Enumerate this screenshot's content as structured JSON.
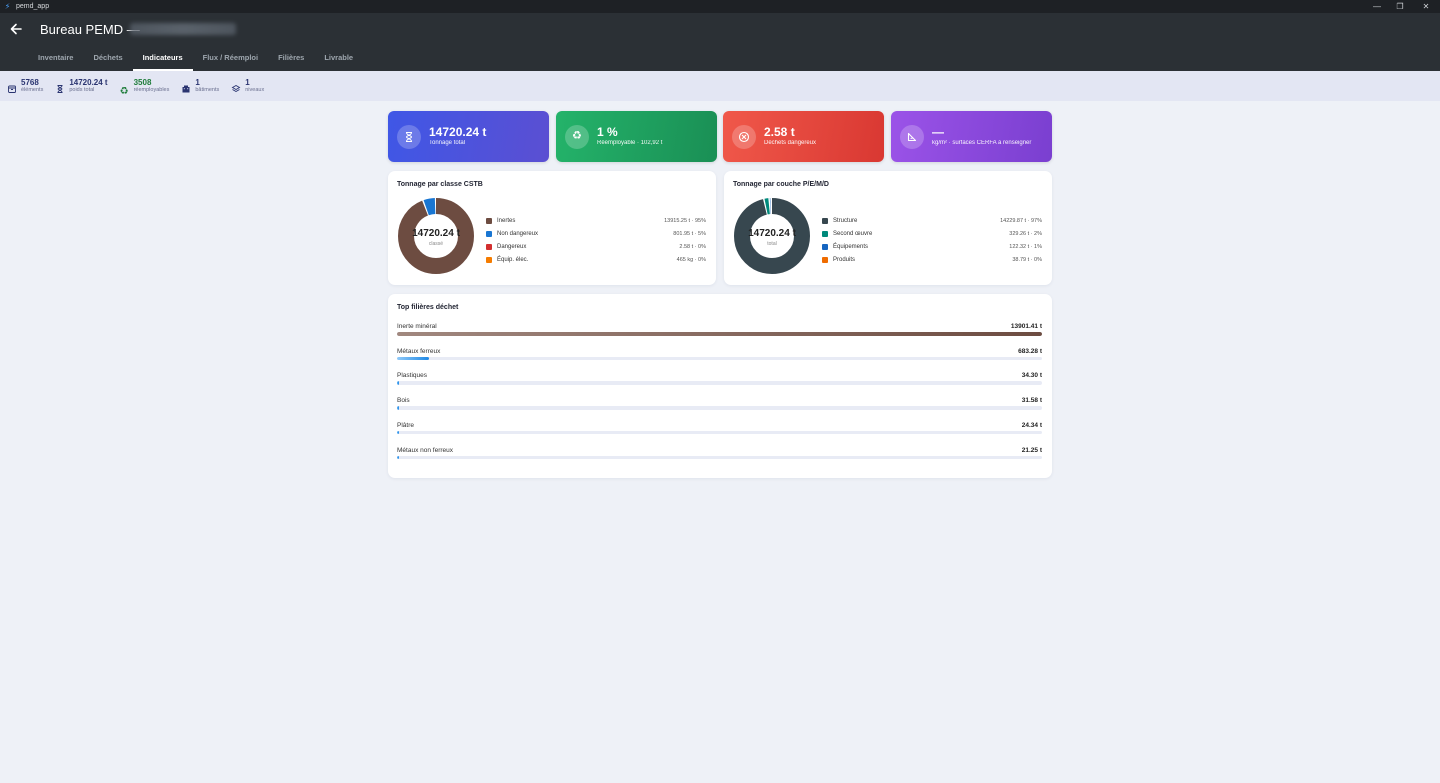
{
  "window": {
    "app_name": "pemd_app"
  },
  "header": {
    "title": "Bureau PEMD —"
  },
  "tabs": [
    {
      "label": "Inventaire",
      "active": false
    },
    {
      "label": "Déchets",
      "active": false
    },
    {
      "label": "Indicateurs",
      "active": true
    },
    {
      "label": "Flux / Réemploi",
      "active": false
    },
    {
      "label": "Filières",
      "active": false
    },
    {
      "label": "Livrable",
      "active": false
    }
  ],
  "stats": [
    {
      "value": "5768",
      "label": "éléments",
      "icon": "box-icon"
    },
    {
      "value": "14720.24 t",
      "label": "poids total",
      "icon": "hourglass-icon"
    },
    {
      "value": "3508",
      "label": "réemployables",
      "icon": "recycle-icon"
    },
    {
      "value": "1",
      "label": "bâtiments",
      "icon": "building-icon"
    },
    {
      "value": "1",
      "label": "niveaux",
      "icon": "layers-icon"
    }
  ],
  "kpis": [
    {
      "value": "14720.24 t",
      "label": "Tonnage total",
      "icon": "hourglass-icon"
    },
    {
      "value": "1 %",
      "label": "Réemployable · 102,92 t",
      "icon": "recycle-icon"
    },
    {
      "value": "2.58 t",
      "label": "Déchets dangereux",
      "icon": "danger-icon"
    },
    {
      "value": "—",
      "label": "kg/m² · surfaces CERFA à renseigner",
      "icon": "ruler-triangle-icon"
    }
  ],
  "colors": {
    "inertes": "#6d4c41",
    "non_dangereux": "#1976d2",
    "dangereux": "#d32f2f",
    "equip": "#f57c00",
    "structure": "#37474f",
    "second_oeuvre": "#00897b",
    "equipements": "#1565c0",
    "produits": "#ef6c00"
  },
  "chart_data": [
    {
      "type": "pie",
      "title": "Tonnage par classe CSTB",
      "center_value": "14720.24 t",
      "center_label": "classé",
      "unit": "t",
      "slices": [
        {
          "name": "Inertes",
          "value": 13915.25,
          "label": "13915.25 t · 95%",
          "color": "#6d4c41"
        },
        {
          "name": "Non dangereux",
          "value": 801.95,
          "label": "801.95 t · 5%",
          "color": "#1976d2"
        },
        {
          "name": "Dangereux",
          "value": 2.58,
          "label": "2.58 t · 0%",
          "color": "#d32f2f"
        },
        {
          "name": "Équip. élec.",
          "value": 0.465,
          "label": "465 kg · 0%",
          "color": "#f57c00"
        }
      ]
    },
    {
      "type": "pie",
      "title": "Tonnage par couche P/E/M/D",
      "center_value": "14720.24 t",
      "center_label": "total",
      "unit": "t",
      "slices": [
        {
          "name": "Structure",
          "value": 14229.87,
          "label": "14229.87 t · 97%",
          "color": "#37474f"
        },
        {
          "name": "Second œuvre",
          "value": 329.26,
          "label": "329.26 t · 2%",
          "color": "#00897b"
        },
        {
          "name": "Équipements",
          "value": 122.32,
          "label": "122.32 t · 1%",
          "color": "#1565c0"
        },
        {
          "name": "Produits",
          "value": 38.79,
          "label": "38.79 t · 0%",
          "color": "#ef6c00"
        }
      ]
    },
    {
      "type": "bar",
      "title": "Top filières déchet",
      "orientation": "horizontal",
      "unit": "t",
      "categories": [
        "Inerte minéral",
        "Métaux ferreux",
        "Plastiques",
        "Bois",
        "Plâtre",
        "Métaux non ferreux"
      ],
      "values": [
        13901.41,
        683.28,
        34.3,
        31.58,
        24.34,
        21.25
      ],
      "value_labels": [
        "13901.41 t",
        "683.28 t",
        "34.30 t",
        "31.58 t",
        "24.34 t",
        "21.25 t"
      ],
      "xlim": [
        0,
        13901.41
      ]
    }
  ]
}
